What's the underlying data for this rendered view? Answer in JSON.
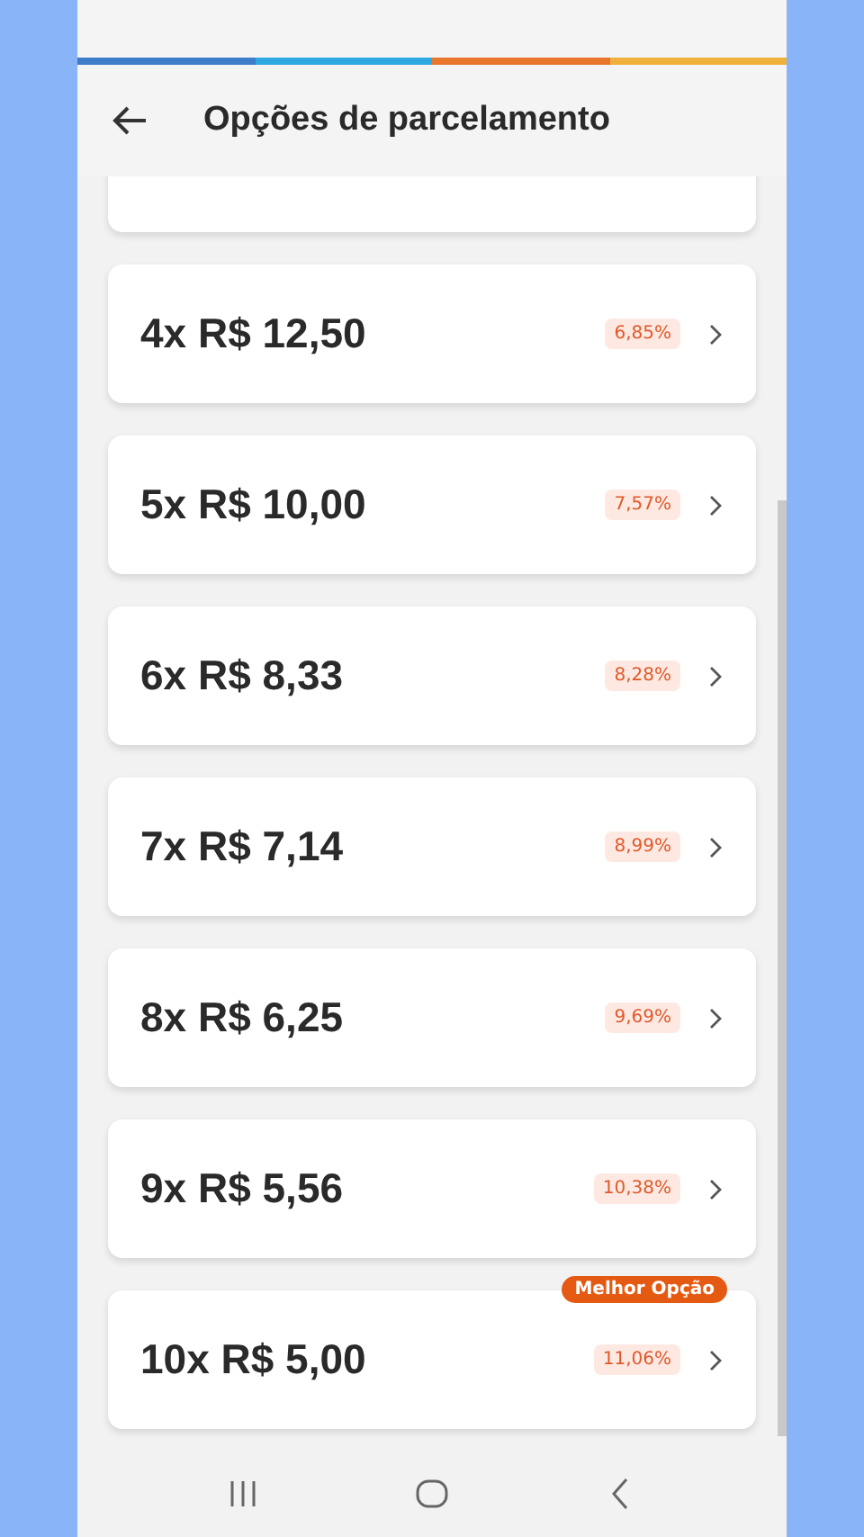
{
  "header": {
    "title": "Opções de parcelamento"
  },
  "options": [
    {
      "label": "4x R$ 12,50",
      "rate": "6,85%"
    },
    {
      "label": "5x R$ 10,00",
      "rate": "7,57%"
    },
    {
      "label": "6x R$ 8,33",
      "rate": "8,28%"
    },
    {
      "label": "7x R$ 7,14",
      "rate": "8,99%"
    },
    {
      "label": "8x R$ 6,25",
      "rate": "9,69%"
    },
    {
      "label": "9x R$ 5,56",
      "rate": "10,38%"
    },
    {
      "label": "10x R$ 5,00",
      "rate": "11,06%",
      "tag": "Melhor Opção"
    }
  ]
}
